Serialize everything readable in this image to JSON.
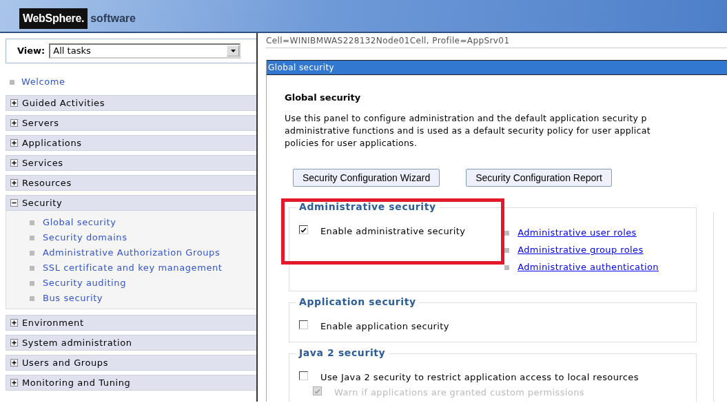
{
  "header": {
    "brand": "WebSphere.",
    "product": "software"
  },
  "nav": {
    "view_label": "View:",
    "view_value": "All tasks",
    "items": [
      {
        "kind": "link",
        "label": "Welcome"
      },
      {
        "kind": "group",
        "label": "Guided Activities",
        "expanded": false
      },
      {
        "kind": "group",
        "label": "Servers",
        "expanded": false
      },
      {
        "kind": "group",
        "label": "Applications",
        "expanded": false
      },
      {
        "kind": "group",
        "label": "Services",
        "expanded": false
      },
      {
        "kind": "group",
        "label": "Resources",
        "expanded": false
      },
      {
        "kind": "group",
        "label": "Security",
        "expanded": true,
        "children": [
          {
            "label": "Global security"
          },
          {
            "label": "Security domains"
          },
          {
            "label": "Administrative Authorization Groups"
          },
          {
            "label": "SSL certificate and key management"
          },
          {
            "label": "Security auditing"
          },
          {
            "label": "Bus security"
          }
        ]
      },
      {
        "kind": "group",
        "label": "Environment",
        "expanded": false
      },
      {
        "kind": "group",
        "label": "System administration",
        "expanded": false
      },
      {
        "kind": "group",
        "label": "Users and Groups",
        "expanded": false
      },
      {
        "kind": "group",
        "label": "Monitoring and Tuning",
        "expanded": false
      }
    ]
  },
  "content": {
    "breadcrumb": "Cell=WINIBMWAS228132Node01Cell, Profile=AppSrv01",
    "panel_title": "Global security",
    "heading": "Global security",
    "description_lines": [
      "Use this panel to configure administration and the default application security p",
      "administrative functions and is used as a default security policy for user applicat",
      "policies for user applications."
    ],
    "buttons": [
      "Security Configuration Wizard",
      "Security Configuration Report"
    ],
    "sections": [
      {
        "title": "Administrative security",
        "highlighted": true,
        "options": [
          {
            "label": "Enable administrative security",
            "checked": true,
            "disabled": false
          }
        ],
        "links": [
          "Administrative user roles",
          "Administrative group roles",
          "Administrative authentication"
        ]
      },
      {
        "title": "Application security",
        "highlighted": false,
        "options": [
          {
            "label": "Enable application security",
            "checked": false,
            "disabled": false
          }
        ]
      },
      {
        "title": "Java 2 security",
        "highlighted": false,
        "options": [
          {
            "label": "Use Java 2 security to restrict application access to local resources",
            "checked": false,
            "disabled": false,
            "children": [
              {
                "label": "Warn if applications are granted custom permissions",
                "checked": true,
                "disabled": true
              }
            ]
          }
        ]
      }
    ]
  }
}
